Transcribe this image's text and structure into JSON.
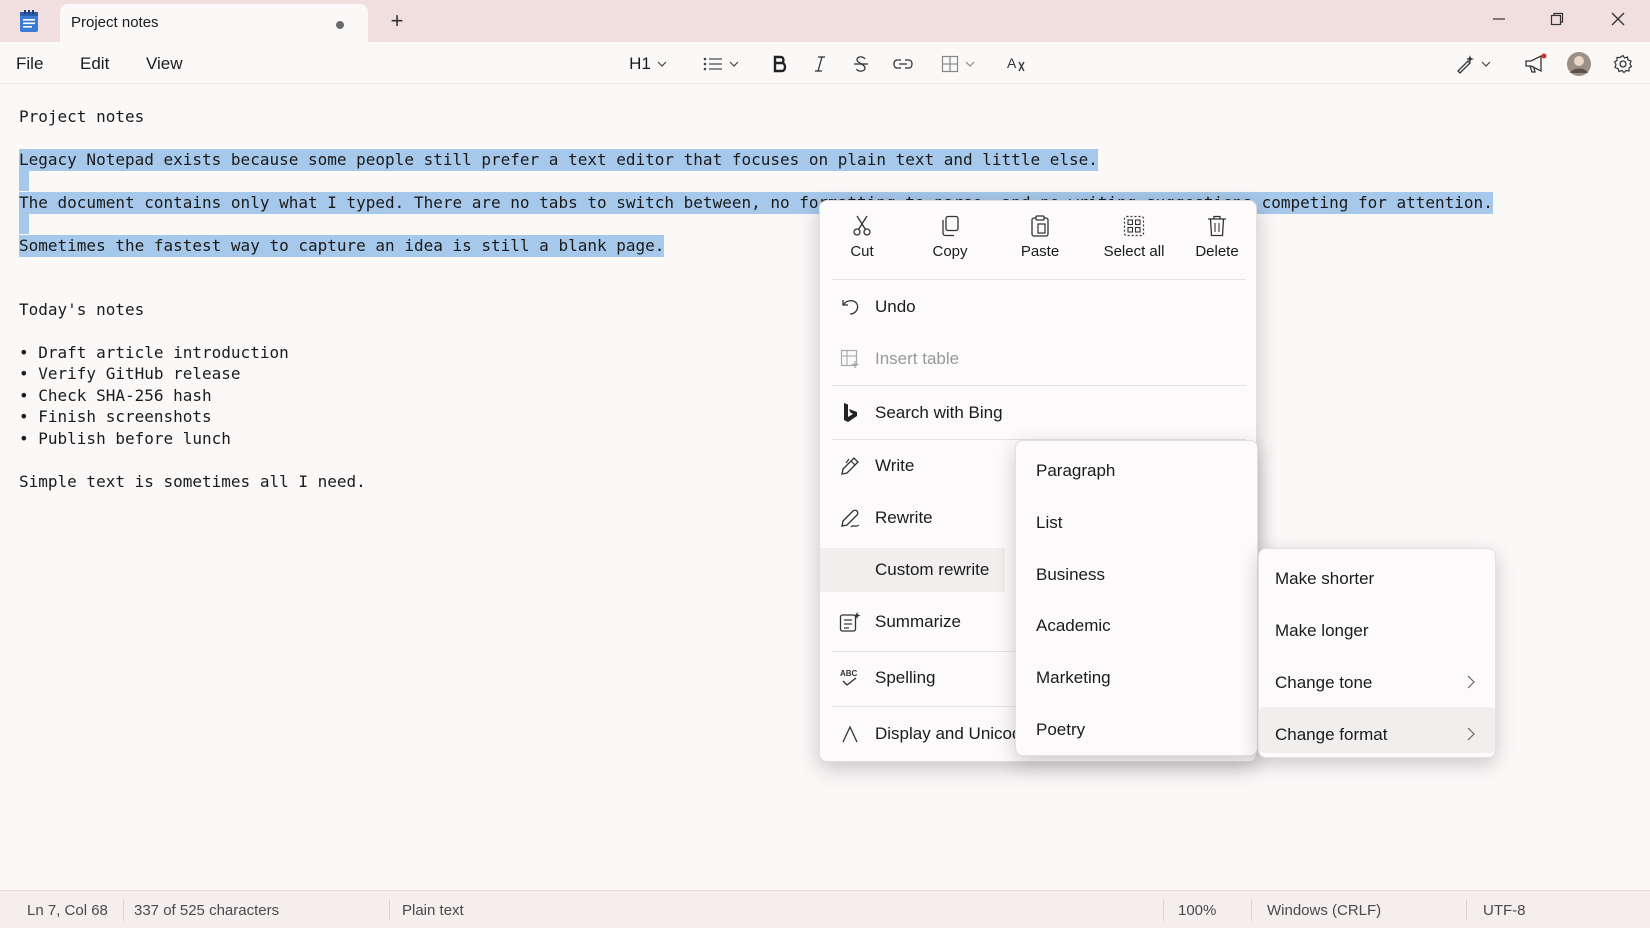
{
  "window": {
    "tab_title": "Project notes",
    "new_tab_symbol": "+"
  },
  "menu": {
    "file": "File",
    "edit": "Edit",
    "view": "View"
  },
  "toolbar": {
    "heading": "H1"
  },
  "document": {
    "title_line": "Project notes",
    "selected": [
      "Legacy Notepad exists because some people still prefer a text editor that focuses on plain text and little else.",
      "The document contains only what I typed. There are no tabs to switch between, no formatting to parse, and no writing suggestions competing for attention.",
      "Sometimes the fastest way to capture an idea is still a blank page."
    ],
    "todays_heading": "Today's notes",
    "bullets": [
      "• Draft article introduction",
      "• Verify GitHub release",
      "• Check SHA-256 hash",
      "• Finish screenshots",
      "• Publish before lunch"
    ],
    "closing": "Simple text is sometimes all I need."
  },
  "context_menu": {
    "quick_actions": [
      {
        "label": "Cut",
        "icon": "scissors-icon"
      },
      {
        "label": "Copy",
        "icon": "copy-icon"
      },
      {
        "label": "Paste",
        "icon": "paste-icon"
      },
      {
        "label": "Select all",
        "icon": "select-all-icon"
      },
      {
        "label": "Delete",
        "icon": "trash-icon"
      }
    ],
    "undo": "Undo",
    "insert_table": "Insert table",
    "search_bing": "Search with Bing",
    "write": "Write",
    "rewrite": "Rewrite",
    "custom_rewrite": "Custom rewrite",
    "summarize": "Summarize",
    "spelling": "Spelling",
    "display_unicode": "Display and Unicode"
  },
  "format_submenu": {
    "items": [
      "Paragraph",
      "List",
      "Business",
      "Academic",
      "Marketing",
      "Poetry"
    ]
  },
  "rewrite_submenu": {
    "items": [
      "Make shorter",
      "Make longer",
      "Change tone",
      "Change format"
    ]
  },
  "status_bar": {
    "position": "Ln 7, Col 68",
    "characters": "337 of 525 characters",
    "format": "Plain text",
    "zoom": "100%",
    "line_endings": "Windows (CRLF)",
    "encoding": "UTF-8"
  },
  "colors": {
    "selection": "#a6c8ea",
    "titlebar": "#f1dfdf",
    "background": "#fbf8f8"
  }
}
